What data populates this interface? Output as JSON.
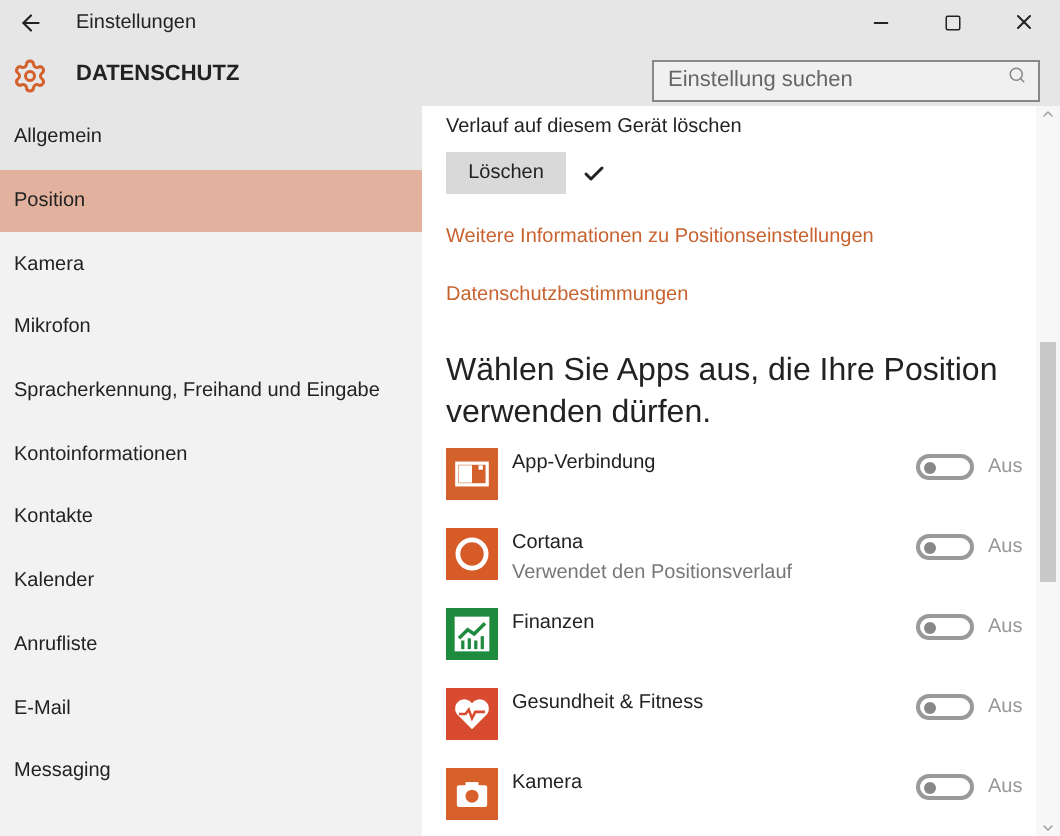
{
  "window": {
    "title": "Einstellungen"
  },
  "header": {
    "title": "DATENSCHUTZ",
    "search": {
      "placeholder": "Einstellung suchen"
    }
  },
  "sidebar": {
    "items": [
      {
        "label": "Allgemein",
        "selected": false,
        "hovered": true
      },
      {
        "label": "Position",
        "selected": true
      },
      {
        "label": "Kamera",
        "selected": false
      },
      {
        "label": "Mikrofon",
        "selected": false
      },
      {
        "label": "Spracherkennung, Freihand und Eingabe",
        "selected": false
      },
      {
        "label": "Kontoinformationen",
        "selected": false
      },
      {
        "label": "Kontakte",
        "selected": false
      },
      {
        "label": "Kalender",
        "selected": false
      },
      {
        "label": "Anrufliste",
        "selected": false
      },
      {
        "label": "E-Mail",
        "selected": false
      },
      {
        "label": "Messaging",
        "selected": false
      }
    ]
  },
  "content": {
    "history_label": "Verlauf auf diesem Gerät löschen",
    "clear_button": "Löschen",
    "cleared": true,
    "links": [
      "Weitere Informationen zu Positionseinstellungen",
      "Datenschutzbestimmungen"
    ],
    "apps_heading": "Wählen Sie Apps aus, die Ihre Position verwenden dürfen.",
    "apps": [
      {
        "name": "App-Verbindung",
        "color": "#d4612c",
        "on": false,
        "state": "Aus"
      },
      {
        "name": "Cortana",
        "subtitle": "Verwendet den Positionsverlauf",
        "color": "#d65b27",
        "on": false,
        "state": "Aus"
      },
      {
        "name": "Finanzen",
        "color": "#1e8a3e",
        "on": false,
        "state": "Aus"
      },
      {
        "name": "Gesundheit & Fitness",
        "color": "#d84b30",
        "on": false,
        "state": "Aus"
      },
      {
        "name": "Kamera",
        "color": "#d8612b",
        "on": false,
        "state": "Aus"
      }
    ]
  }
}
